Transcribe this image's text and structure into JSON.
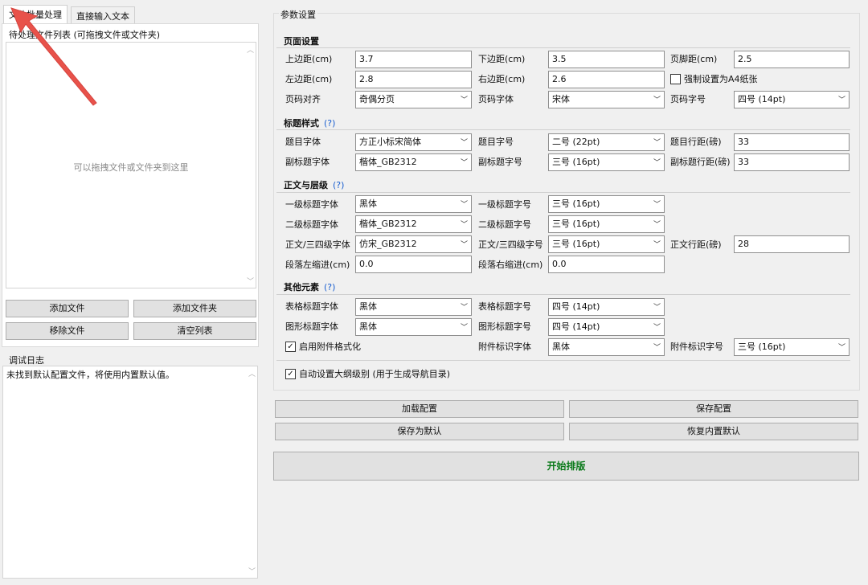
{
  "tabs": [
    "文件批量处理",
    "直接输入文本"
  ],
  "file_list": {
    "label": "待处理文件列表 (可拖拽文件或文件夹)",
    "hint": "可以拖拽文件或文件夹到这里"
  },
  "file_buttons": {
    "add_file": "添加文件",
    "add_folder": "添加文件夹",
    "remove_file": "移除文件",
    "clear_list": "清空列表"
  },
  "log": {
    "label": "调试日志",
    "text": "未找到默认配置文件，将使用内置默认值。"
  },
  "params": {
    "title": "参数设置",
    "page_setup": {
      "title": "页面设置",
      "top_margin_label": "上边距(cm)",
      "top_margin": "3.7",
      "bottom_margin_label": "下边距(cm)",
      "bottom_margin": "3.5",
      "footer_dist_label": "页脚距(cm)",
      "footer_dist": "2.5",
      "left_margin_label": "左边距(cm)",
      "left_margin": "2.8",
      "right_margin_label": "右边距(cm)",
      "right_margin": "2.6",
      "force_a4_label": "强制设置为A4纸张",
      "page_align_label": "页码对齐",
      "page_align": "奇偶分页",
      "page_font_label": "页码字体",
      "page_font": "宋体",
      "page_size_label": "页码字号",
      "page_size": "四号 (14pt)"
    },
    "title_style": {
      "title": "标题样式",
      "help": "(?)",
      "title_font_label": "题目字体",
      "title_font": "方正小标宋简体",
      "title_size_label": "题目字号",
      "title_size": "二号 (22pt)",
      "title_spacing_label": "题目行距(磅)",
      "title_spacing": "33",
      "subtitle_font_label": "副标题字体",
      "subtitle_font": "楷体_GB2312",
      "subtitle_size_label": "副标题字号",
      "subtitle_size": "三号 (16pt)",
      "subtitle_spacing_label": "副标题行距(磅)",
      "subtitle_spacing": "33"
    },
    "body_levels": {
      "title": "正文与层级",
      "help": "(?)",
      "h1_font_label": "一级标题字体",
      "h1_font": "黑体",
      "h1_size_label": "一级标题字号",
      "h1_size": "三号 (16pt)",
      "h2_font_label": "二级标题字体",
      "h2_font": "楷体_GB2312",
      "h2_size_label": "二级标题字号",
      "h2_size": "三号 (16pt)",
      "body_font_label": "正文/三四级字体",
      "body_font": "仿宋_GB2312",
      "body_size_label": "正文/三四级字号",
      "body_size": "三号 (16pt)",
      "body_spacing_label": "正文行距(磅)",
      "body_spacing": "28",
      "indent_left_label": "段落左缩进(cm)",
      "indent_left": "0.0",
      "indent_right_label": "段落右缩进(cm)",
      "indent_right": "0.0"
    },
    "other": {
      "title": "其他元素",
      "help": "(?)",
      "table_font_label": "表格标题字体",
      "table_font": "黑体",
      "table_size_label": "表格标题字号",
      "table_size": "四号 (14pt)",
      "figure_font_label": "图形标题字体",
      "figure_font": "黑体",
      "figure_size_label": "图形标题字号",
      "figure_size": "四号 (14pt)",
      "attach_format_label": "启用附件格式化",
      "attach_font_label": "附件标识字体",
      "attach_font": "黑体",
      "attach_size_label": "附件标识字号",
      "attach_size": "三号 (16pt)"
    },
    "auto_outline_label": "自动设置大纲级别 (用于生成导航目录)"
  },
  "config_buttons": {
    "load": "加载配置",
    "save": "保存配置",
    "save_default": "保存为默认",
    "restore_default": "恢复内置默认"
  },
  "start_button": "开始排版",
  "colors": {
    "start_text": "#0b7a1b",
    "help_link": "#1a5fd0",
    "arrow": "#e8524a"
  }
}
